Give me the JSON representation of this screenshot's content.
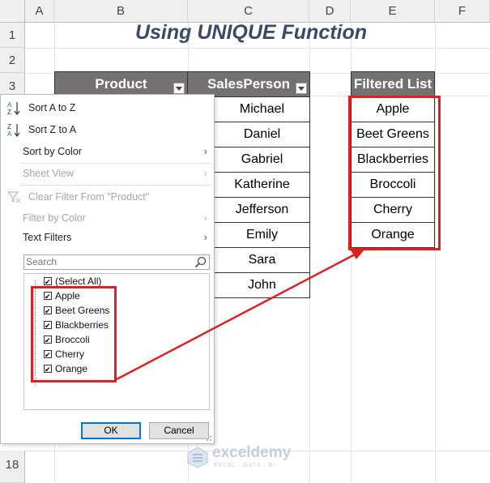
{
  "sheet": {
    "columns": [
      "A",
      "B",
      "C",
      "D",
      "E",
      "F"
    ],
    "rows": [
      "1",
      "2",
      "3",
      "18"
    ]
  },
  "title": "Using UNIQUE Function",
  "table": {
    "product_header": "Product",
    "salesperson_header": "SalesPerson",
    "salespersons": [
      "Michael",
      "Daniel",
      "Gabriel",
      "Katherine",
      "Jefferson",
      "Emily",
      "Sara",
      "John"
    ]
  },
  "filtered": {
    "header": "Filtered List",
    "items": [
      "Apple",
      "Beet Greens",
      "Blackberries",
      "Broccoli",
      "Cherry",
      "Orange"
    ]
  },
  "filter_menu": {
    "sort_az": "Sort A to Z",
    "sort_za": "Sort Z to A",
    "sort_by_color": "Sort by Color",
    "sheet_view": "Sheet View",
    "clear_filter": "Clear Filter From \"Product\"",
    "filter_by_color": "Filter by Color",
    "text_filters": "Text Filters",
    "search_placeholder": "Search",
    "select_all": "(Select All)",
    "options": [
      "Apple",
      "Beet Greens",
      "Blackberries",
      "Broccoli",
      "Cherry",
      "Orange"
    ],
    "ok": "OK",
    "cancel": "Cancel"
  },
  "watermark": {
    "brand": "exceldemy",
    "tagline": "EXCEL · DATA · BI"
  },
  "colors": {
    "header_fill": "#757171",
    "highlight": "#e02020",
    "title": "#3b4a6b"
  },
  "icons": {
    "dropdown": "chevron-down-icon",
    "search": "magnifier-icon",
    "sort_az": "sort-az-icon",
    "sort_za": "sort-za-icon",
    "clear_filter": "funnel-clear-icon"
  }
}
